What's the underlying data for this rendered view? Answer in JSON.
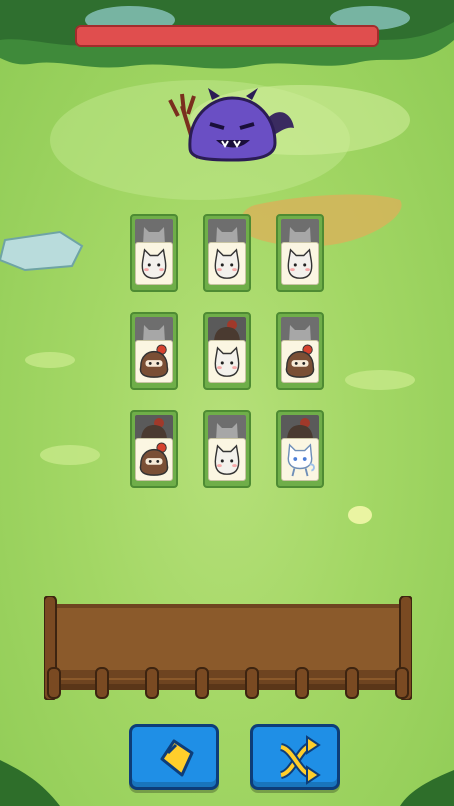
{
  "boss": {
    "name_icon": "devil-slime-boss",
    "hp_fraction": 1.0,
    "hp_color": "#e04e4e"
  },
  "grid": {
    "rows": [
      [
        {
          "top": "cat",
          "face": "cat"
        },
        {
          "top": "cat",
          "face": "cat"
        },
        {
          "top": "cat",
          "face": "cat"
        }
      ],
      [
        {
          "top": "cat",
          "face": "ninja"
        },
        {
          "top": "ninja",
          "face": "cat"
        },
        {
          "top": "cat",
          "face": "ninja"
        }
      ],
      [
        {
          "top": "ninja",
          "face": "ninja"
        },
        {
          "top": "cat",
          "face": "cat"
        },
        {
          "top": "ninja",
          "face": "ice-cat"
        }
      ]
    ]
  },
  "buttons": [
    {
      "name": "card-button",
      "icon": "card-hand-icon"
    },
    {
      "name": "shuffle-button",
      "icon": "shuffle-arrows-icon"
    }
  ],
  "colors": {
    "grass": "#a3d765",
    "tile_border": "#4e8b33",
    "button": "#1f8fe6",
    "wood": "#8b5a2b"
  }
}
